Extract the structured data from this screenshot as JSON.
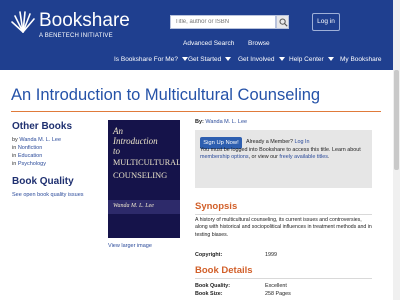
{
  "header": {
    "brand": "Bookshare",
    "tagline": "A BENETECH INITIATIVE",
    "search_placeholder": "Title, author or ISBN",
    "login": "Log in",
    "links_row1": {
      "advanced": "Advanced Search",
      "browse": "Browse"
    },
    "nav": {
      "for_me": "Is Bookshare For Me?",
      "get_started": "Get Started",
      "get_involved": "Get Involved",
      "help": "Help Center",
      "my": "My Bookshare"
    }
  },
  "book": {
    "title": "An Introduction to Multicultural Counseling",
    "by_label": "By:",
    "author": "Wanda M. L. Lee",
    "cover": {
      "line1": "An",
      "line2": "Introduction",
      "line3": "to",
      "line4": "MULTICULTURAL",
      "line5": "COUNSELING",
      "author": "Wanda M. L. Lee"
    },
    "view_larger": "View larger image"
  },
  "sidebar": {
    "other_books_heading": "Other Books",
    "by_prefix": "by",
    "by_author": "Wanda M. L. Lee",
    "in_prefix": "in",
    "categories": [
      "Nonfiction",
      "Education",
      "Psychology"
    ],
    "quality_heading": "Book Quality",
    "quality_link": "See open book quality issues"
  },
  "signup": {
    "button": "Sign Up Now!",
    "already": "Already a Member?",
    "log_in": "Log In",
    "text1": "You must be logged into Bookshare to access this title. Learn about",
    "membership_options": "membership options",
    "text2": ", or view our",
    "free_titles": "freely available titles",
    "text3": "."
  },
  "synopsis": {
    "heading": "Synopsis",
    "text": "A history of multicultural counseling, its current issues and controversies, along with historical and sociopolitical influences in treatment methods and in testing biases.",
    "copyright_label": "Copyright:",
    "copyright": "1999"
  },
  "details": {
    "heading": "Book Details",
    "quality_label": "Book Quality:",
    "quality": "Excellent",
    "size_label": "Book Size:",
    "size": "258 Pages"
  },
  "colors": {
    "header_bg": "#1f3f8f",
    "title": "#2552a8",
    "accent_orange": "#d2602a",
    "link": "#2a4a9a"
  }
}
